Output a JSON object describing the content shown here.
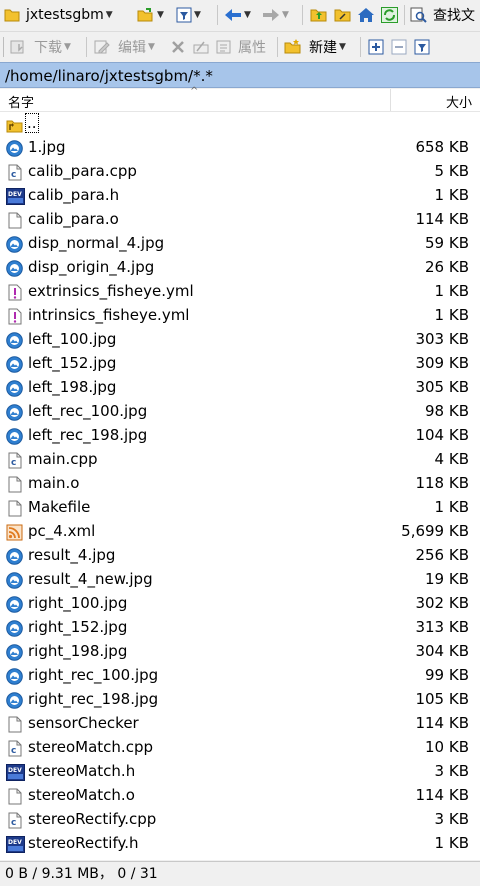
{
  "toolbar1": {
    "folder_name": "jxtestsgbm",
    "search_label": "查找文"
  },
  "toolbar2": {
    "download_label": "下载",
    "edit_label": "编辑",
    "properties_label": "属性",
    "new_label": "新建"
  },
  "path": "/home/linaro/jxtestsgbm/*.*",
  "columns": {
    "name": "名字",
    "size": "大小"
  },
  "files": [
    {
      "name": "..",
      "size": "",
      "icon": "parent-folder-icon"
    },
    {
      "name": "1.jpg",
      "size": "658 KB",
      "icon": "image-file-icon"
    },
    {
      "name": "calib_para.cpp",
      "size": "5 KB",
      "icon": "cpp-file-icon"
    },
    {
      "name": "calib_para.h",
      "size": "1 KB",
      "icon": "header-file-icon"
    },
    {
      "name": "calib_para.o",
      "size": "114 KB",
      "icon": "blank-file-icon"
    },
    {
      "name": "disp_normal_4.jpg",
      "size": "59 KB",
      "icon": "image-file-icon"
    },
    {
      "name": "disp_origin_4.jpg",
      "size": "26 KB",
      "icon": "image-file-icon"
    },
    {
      "name": "extrinsics_fisheye.yml",
      "size": "1 KB",
      "icon": "yml-file-icon"
    },
    {
      "name": "intrinsics_fisheye.yml",
      "size": "1 KB",
      "icon": "yml-file-icon"
    },
    {
      "name": "left_100.jpg",
      "size": "303 KB",
      "icon": "image-file-icon"
    },
    {
      "name": "left_152.jpg",
      "size": "309 KB",
      "icon": "image-file-icon"
    },
    {
      "name": "left_198.jpg",
      "size": "305 KB",
      "icon": "image-file-icon"
    },
    {
      "name": "left_rec_100.jpg",
      "size": "98 KB",
      "icon": "image-file-icon"
    },
    {
      "name": "left_rec_198.jpg",
      "size": "104 KB",
      "icon": "image-file-icon"
    },
    {
      "name": "main.cpp",
      "size": "4 KB",
      "icon": "cpp-file-icon"
    },
    {
      "name": "main.o",
      "size": "118 KB",
      "icon": "blank-file-icon"
    },
    {
      "name": "Makefile",
      "size": "1 KB",
      "icon": "blank-file-icon"
    },
    {
      "name": "pc_4.xml",
      "size": "5,699 KB",
      "icon": "xml-file-icon"
    },
    {
      "name": "result_4.jpg",
      "size": "256 KB",
      "icon": "image-file-icon"
    },
    {
      "name": "result_4_new.jpg",
      "size": "19 KB",
      "icon": "image-file-icon"
    },
    {
      "name": "right_100.jpg",
      "size": "302 KB",
      "icon": "image-file-icon"
    },
    {
      "name": "right_152.jpg",
      "size": "313 KB",
      "icon": "image-file-icon"
    },
    {
      "name": "right_198.jpg",
      "size": "304 KB",
      "icon": "image-file-icon"
    },
    {
      "name": "right_rec_100.jpg",
      "size": "99 KB",
      "icon": "image-file-icon"
    },
    {
      "name": "right_rec_198.jpg",
      "size": "105 KB",
      "icon": "image-file-icon"
    },
    {
      "name": "sensorChecker",
      "size": "114 KB",
      "icon": "blank-file-icon"
    },
    {
      "name": "stereoMatch.cpp",
      "size": "10 KB",
      "icon": "cpp-file-icon"
    },
    {
      "name": "stereoMatch.h",
      "size": "3 KB",
      "icon": "header-file-icon"
    },
    {
      "name": "stereoMatch.o",
      "size": "114 KB",
      "icon": "blank-file-icon"
    },
    {
      "name": "stereoRectify.cpp",
      "size": "3 KB",
      "icon": "cpp-file-icon"
    },
    {
      "name": "stereoRectify.h",
      "size": "1 KB",
      "icon": "header-file-icon"
    }
  ],
  "status": "0 B / 9.31 MB， 0 / 31",
  "colors": {
    "path_bar": "#a7c5ea",
    "image_icon": "#2f7fd0",
    "header_icon": "#1d3a8a",
    "xml_icon": "#e07a1f",
    "folder": "#f2c12e"
  }
}
